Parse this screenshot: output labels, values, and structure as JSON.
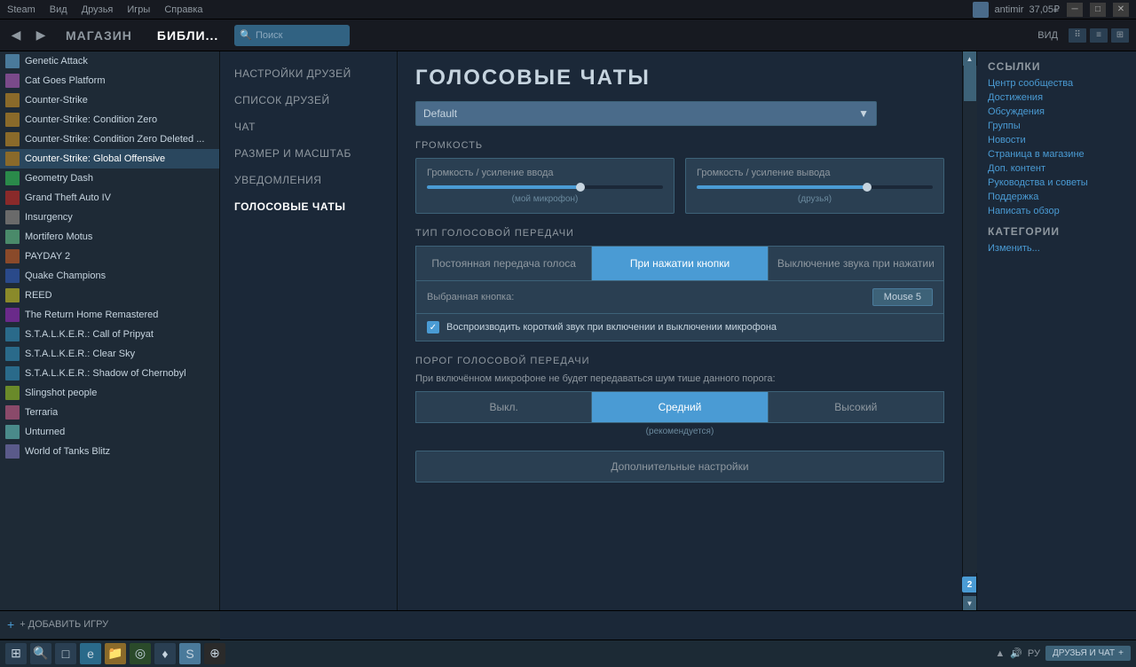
{
  "titlebar": {
    "menus": [
      "Steam",
      "Вид",
      "Друзья",
      "Игры",
      "Справка"
    ],
    "user": "antimir",
    "balance": "37,05₽",
    "close": "✕",
    "maximize": "□",
    "minimize": "─"
  },
  "navbar": {
    "back_arrow": "◀",
    "forward_arrow": "▶",
    "tabs": [
      "МАГАЗИН",
      "БИБЛИ..."
    ],
    "active_tab": "БИБЛИ...",
    "search_placeholder": "Поиск",
    "view_label": "ВИД"
  },
  "sidebar": {
    "games": [
      {
        "name": "Genetic Attack",
        "active": false
      },
      {
        "name": "Cat Goes Platform",
        "active": false
      },
      {
        "name": "Counter-Strike",
        "active": false
      },
      {
        "name": "Counter-Strike: Condition Zero",
        "active": false
      },
      {
        "name": "Counter-Strike: Condition Zero Deleted ...",
        "active": false
      },
      {
        "name": "Counter-Strike: Global Offensive",
        "active": true
      },
      {
        "name": "Geometry Dash",
        "active": false
      },
      {
        "name": "Grand Theft Auto IV",
        "active": false
      },
      {
        "name": "Insurgency",
        "active": false
      },
      {
        "name": "Mortifero Motus",
        "active": false
      },
      {
        "name": "PAYDAY 2",
        "active": false
      },
      {
        "name": "Quake Champions",
        "active": false
      },
      {
        "name": "REED",
        "active": false
      },
      {
        "name": "The Return Home Remastered",
        "active": false
      },
      {
        "name": "S.T.A.L.K.E.R.: Call of Pripyat",
        "active": false
      },
      {
        "name": "S.T.A.L.K.E.R.: Clear Sky",
        "active": false
      },
      {
        "name": "S.T.A.L.K.E.R.: Shadow of Chernobyl",
        "active": false
      },
      {
        "name": "Slingshot people",
        "active": false
      },
      {
        "name": "Terraria",
        "active": false
      },
      {
        "name": "Unturned",
        "active": false
      },
      {
        "name": "World of Tanks Blitz",
        "active": false
      }
    ],
    "add_game": "+ ДОБАВИТЬ ИГРУ"
  },
  "settings_nav": {
    "items": [
      {
        "label": "НАСТРОЙКИ ДРУЗЕЙ",
        "active": false
      },
      {
        "label": "СПИСОК ДРУЗЕЙ",
        "active": false
      },
      {
        "label": "ЧАТ",
        "active": false
      },
      {
        "label": "РАЗМЕР И МАСШТАБ",
        "active": false
      },
      {
        "label": "УВЕДОМЛЕНИЯ",
        "active": false
      },
      {
        "label": "ГОЛОСОВЫЕ ЧАТЫ",
        "active": true
      }
    ]
  },
  "content": {
    "title": "ГОЛОСОВЫЕ ЧАТЫ",
    "dropdown_value": "Default",
    "dropdown_arrow": "▼",
    "volume_section_title": "ГРОМКОСТЬ",
    "volume_input_label": "Громкость / усиление ввода",
    "volume_input_sublabel": "(мой микрофон)",
    "volume_input_fill": 65,
    "volume_output_label": "Громкость / усиление вывода",
    "volume_output_sublabel": "(друзья)",
    "volume_output_fill": 72,
    "voice_type_title": "ТИП ГОЛОСОВОЙ ПЕРЕДАЧИ",
    "voice_btn1": "Постоянная передача голоса",
    "voice_btn2": "При нажатии кнопки",
    "voice_btn3": "Выключение звука при нажатии",
    "voice_active": 1,
    "selected_key_label": "Выбранная кнопка:",
    "selected_key_value": "Mouse 5",
    "sound_toggle_label": "Воспроизводить короткий звук при включении и выключении микрофона",
    "sound_toggle_checked": true,
    "threshold_title": "ПОРОГ ГОЛОСОВОЙ ПЕРЕДАЧИ",
    "threshold_desc": "При включённом микрофоне не будет передаваться шум тише данного порога:",
    "threshold_btn1": "Выкл.",
    "threshold_btn2": "Средний",
    "threshold_btn3": "Высокий",
    "threshold_active": 1,
    "threshold_recommended": "(рекомендуется)",
    "advanced_btn": "Дополнительные настройки"
  },
  "right_sidebar": {
    "links_title": "ССЫЛКИ",
    "links": [
      "Центр сообщества",
      "Достижения",
      "Обсуждения",
      "Группы",
      "Новости",
      "Страница в магазине",
      "Доп. контент",
      "Руководства и советы",
      "Поддержка",
      "Написать обзор"
    ],
    "categories_title": "КАТЕГОРИИ",
    "categories": [
      "Изменить..."
    ],
    "num_badge": "2"
  },
  "taskbar": {
    "icons": [
      "⊞",
      "🔍",
      "□",
      "🌐",
      "◎",
      "♦",
      "⊕"
    ],
    "friends_chat": "ДРУЗЬЯ И ЧАТ",
    "add_icon": "+"
  }
}
